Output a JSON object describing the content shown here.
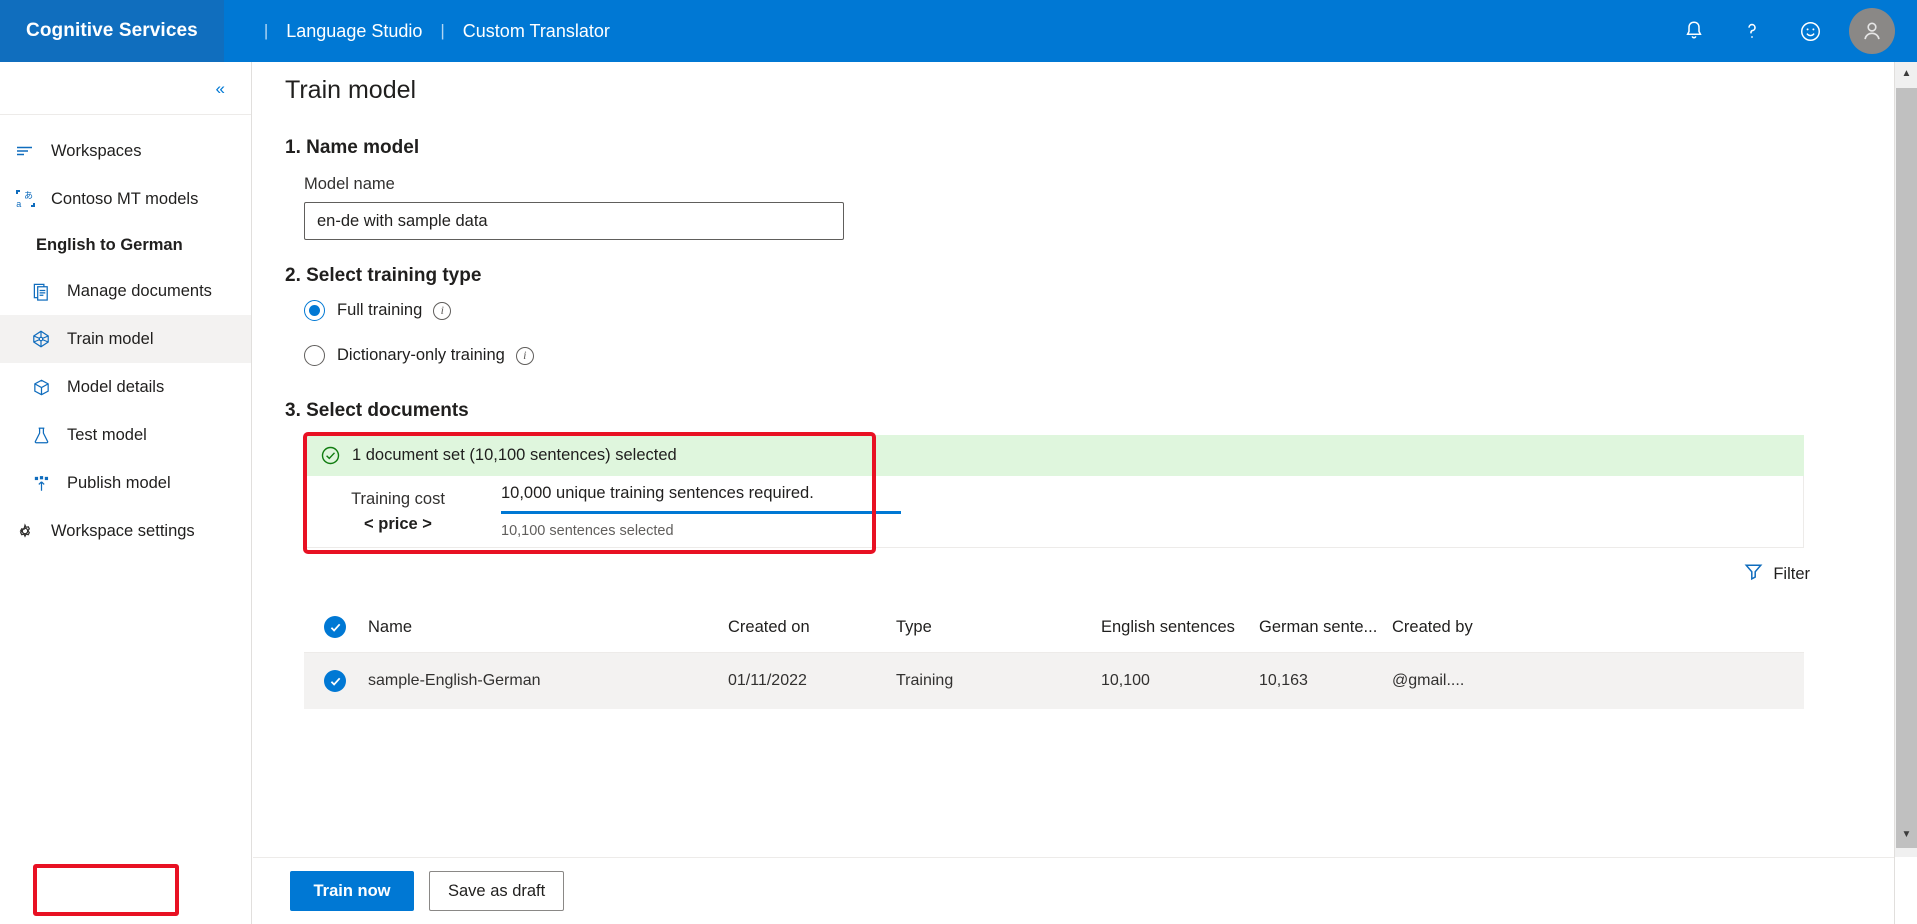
{
  "topbar": {
    "brand": "Cognitive Services",
    "separator": "|",
    "nav": [
      {
        "label": "Language Studio"
      },
      {
        "label": "Custom Translator"
      }
    ],
    "icons": {
      "notifications": "bell-icon",
      "help": "question-mark-icon",
      "feedback": "smiley-icon",
      "account": "user-avatar-icon"
    },
    "accent_color": "#0078d4",
    "brand_block_color": "#106ebe"
  },
  "sidebar": {
    "collapse_glyph": "«",
    "items": [
      {
        "label": "Workspaces",
        "icon": "list-lines-icon",
        "level": "top",
        "selected": false
      },
      {
        "label": "Contoso MT models",
        "icon": "translate-icon",
        "level": "top",
        "selected": false
      }
    ],
    "group_label": "English to German",
    "sub_items": [
      {
        "label": "Manage documents",
        "icon": "documents-icon",
        "selected": false
      },
      {
        "label": "Train model",
        "icon": "train-model-icon",
        "selected": true
      },
      {
        "label": "Model details",
        "icon": "cube-icon",
        "selected": false
      },
      {
        "label": "Test model",
        "icon": "flask-icon",
        "selected": false
      },
      {
        "label": "Publish model",
        "icon": "publish-upload-icon",
        "selected": false
      }
    ],
    "footer_item": {
      "label": "Workspace settings",
      "icon": "gear-icon"
    }
  },
  "main": {
    "page_title": "Train model",
    "step1": {
      "heading": "1. Name model",
      "field_label": "Model name",
      "input_value": "en-de with sample data",
      "input_placeholder": "Model name"
    },
    "step2": {
      "heading": "2. Select training type",
      "options": [
        {
          "label": "Full training",
          "checked": true,
          "info": "info-icon"
        },
        {
          "label": "Dictionary-only training",
          "checked": false,
          "info": "info-icon"
        }
      ]
    },
    "step3": {
      "heading": "3. Select documents",
      "banner": {
        "icon": "check-circle-icon",
        "text": "1 document set (10,100 sentences) selected",
        "background_color": "#dff6dd",
        "icon_color": "#107c10"
      },
      "cost": {
        "label": "Training cost",
        "price": "< price >",
        "required_text": "10,000 unique training sentences required.",
        "selected_text": "10,100 sentences selected",
        "progress_percent": 100,
        "progress_color": "#0078d4"
      },
      "filter": {
        "label": "Filter",
        "icon": "funnel-icon"
      },
      "table": {
        "columns": [
          "Name",
          "Created on",
          "Type",
          "English sentences",
          "German sente...",
          "Created by"
        ],
        "select_all_checked": true,
        "rows": [
          {
            "checked": true,
            "name": "sample-English-German",
            "created_on": "01/11/2022",
            "type": "Training",
            "english_sentences": "10,100",
            "german_sentences": "10,163",
            "created_by": "@gmail...."
          }
        ]
      }
    }
  },
  "footer": {
    "primary_button": "Train now",
    "secondary_button": "Save as draft"
  },
  "annotations": {
    "highlight_color": "#e81123"
  }
}
